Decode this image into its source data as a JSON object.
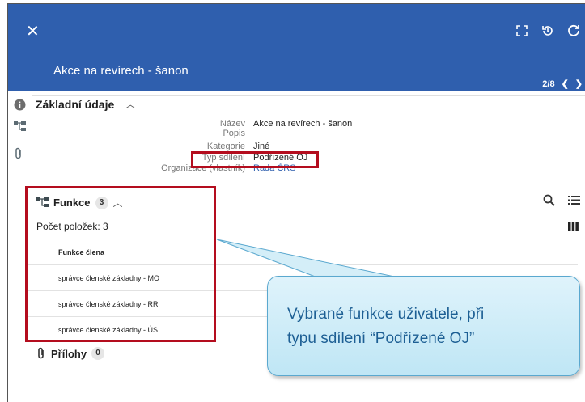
{
  "header": {
    "title": "Akce na revírech - šanon",
    "pager": "2/8",
    "close_icon": "close-icon",
    "colors": {
      "header_bg": "#2f5fae",
      "highlight": "#b40d1e"
    }
  },
  "basic_section": {
    "title": "Základní údaje",
    "fields": [
      {
        "label": "Název",
        "value": "Akce na revírech - šanon"
      },
      {
        "label": "Popis",
        "value": ""
      },
      {
        "label": "Kategorie",
        "value": "Jiné"
      },
      {
        "label": "Typ sdílení",
        "value": "Podřízené OJ"
      },
      {
        "label": "Organizace (vlastník)",
        "value": "Rada ČRS"
      }
    ]
  },
  "functions_section": {
    "title": "Funkce",
    "badge": "3",
    "count_label": "Počet položek: 3",
    "column_header": "Funkce člena",
    "rows": [
      "správce členské základny - MO",
      "správce členské základny - RR",
      "správce členské základny - ÚS"
    ]
  },
  "attachments_section": {
    "title": "Přílohy",
    "badge": "0"
  },
  "callout": {
    "line1": "Vybrané funkce uživatele, při",
    "line2": "typu sdílení “Podřízené OJ”"
  }
}
